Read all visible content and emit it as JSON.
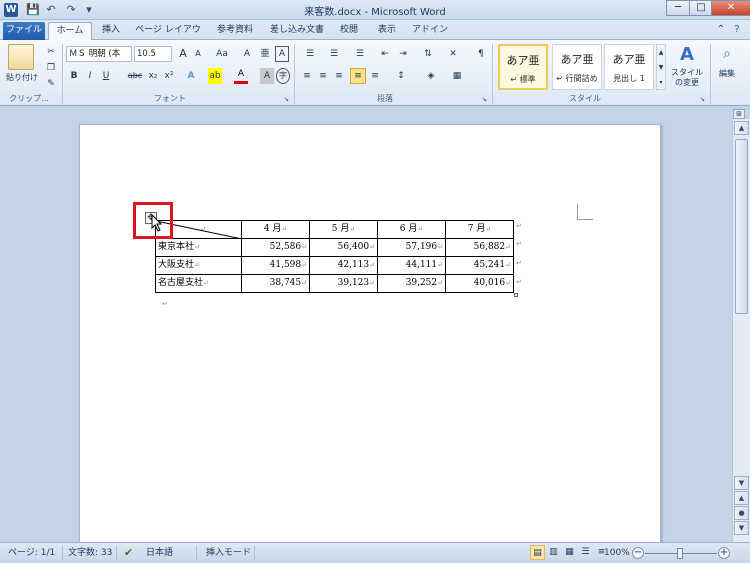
{
  "window": {
    "title": "来客数.docx - Microsoft Word",
    "app_icon_letter": "W",
    "controls": {
      "minimize": "─",
      "maximize": "□",
      "close": "✕"
    }
  },
  "qat": {
    "save_icon": "save-icon",
    "undo_icon": "undo-icon",
    "redo_icon": "redo-icon",
    "customize_icon": "customize-icon"
  },
  "tabs": [
    "ファイル",
    "ホーム",
    "挿入",
    "ページ レイアウト",
    "参考資料",
    "差し込み文書",
    "校閲",
    "表示",
    "アドイン"
  ],
  "ribbon": {
    "clipboard": {
      "paste_label": "貼り付け",
      "group_label": "クリップ..."
    },
    "font": {
      "font_name": "ＭＳ 明朝 (本",
      "font_size": "10.5",
      "grow": "A",
      "shrink": "A",
      "change_case": "Aa",
      "clear_format": "A",
      "phonetic": "亜",
      "char_border": "A",
      "bold": "B",
      "italic": "I",
      "underline": "U",
      "strike": "abc",
      "subscript": "x₂",
      "superscript": "x²",
      "text_effect": "A",
      "highlight": "ab",
      "font_color": "A",
      "char_shading": "A",
      "enclosed": "字",
      "group_label": "フォント"
    },
    "paragraph": {
      "group_label": "段落"
    },
    "styles": {
      "items": [
        {
          "sample": "あア亜",
          "name": "↵ 標準"
        },
        {
          "sample": "あア亜",
          "name": "↵ 行間詰め"
        },
        {
          "sample": "あア亜",
          "name": "見出し 1"
        }
      ],
      "change_styles": "スタイルの変更",
      "group_label": "スタイル"
    },
    "editing": {
      "label": "編集"
    }
  },
  "table": {
    "headers": [
      "4 月",
      "5 月",
      "6 月",
      "7 月"
    ],
    "rows": [
      {
        "label": "東京本社",
        "values": [
          "52,586",
          "56,400",
          "57,196",
          "56,882"
        ]
      },
      {
        "label": "大阪支社",
        "values": [
          "41,598",
          "42,113",
          "44,111",
          "45,241"
        ]
      },
      {
        "label": "名古屋支社",
        "values": [
          "38,745",
          "39,123",
          "39,252",
          "40,016"
        ]
      }
    ],
    "cell_mark": "↵"
  },
  "status": {
    "page": "ページ: 1/1",
    "words": "文字数: 33",
    "language": "日本語",
    "mode": "挿入モード",
    "zoom": "100%"
  }
}
